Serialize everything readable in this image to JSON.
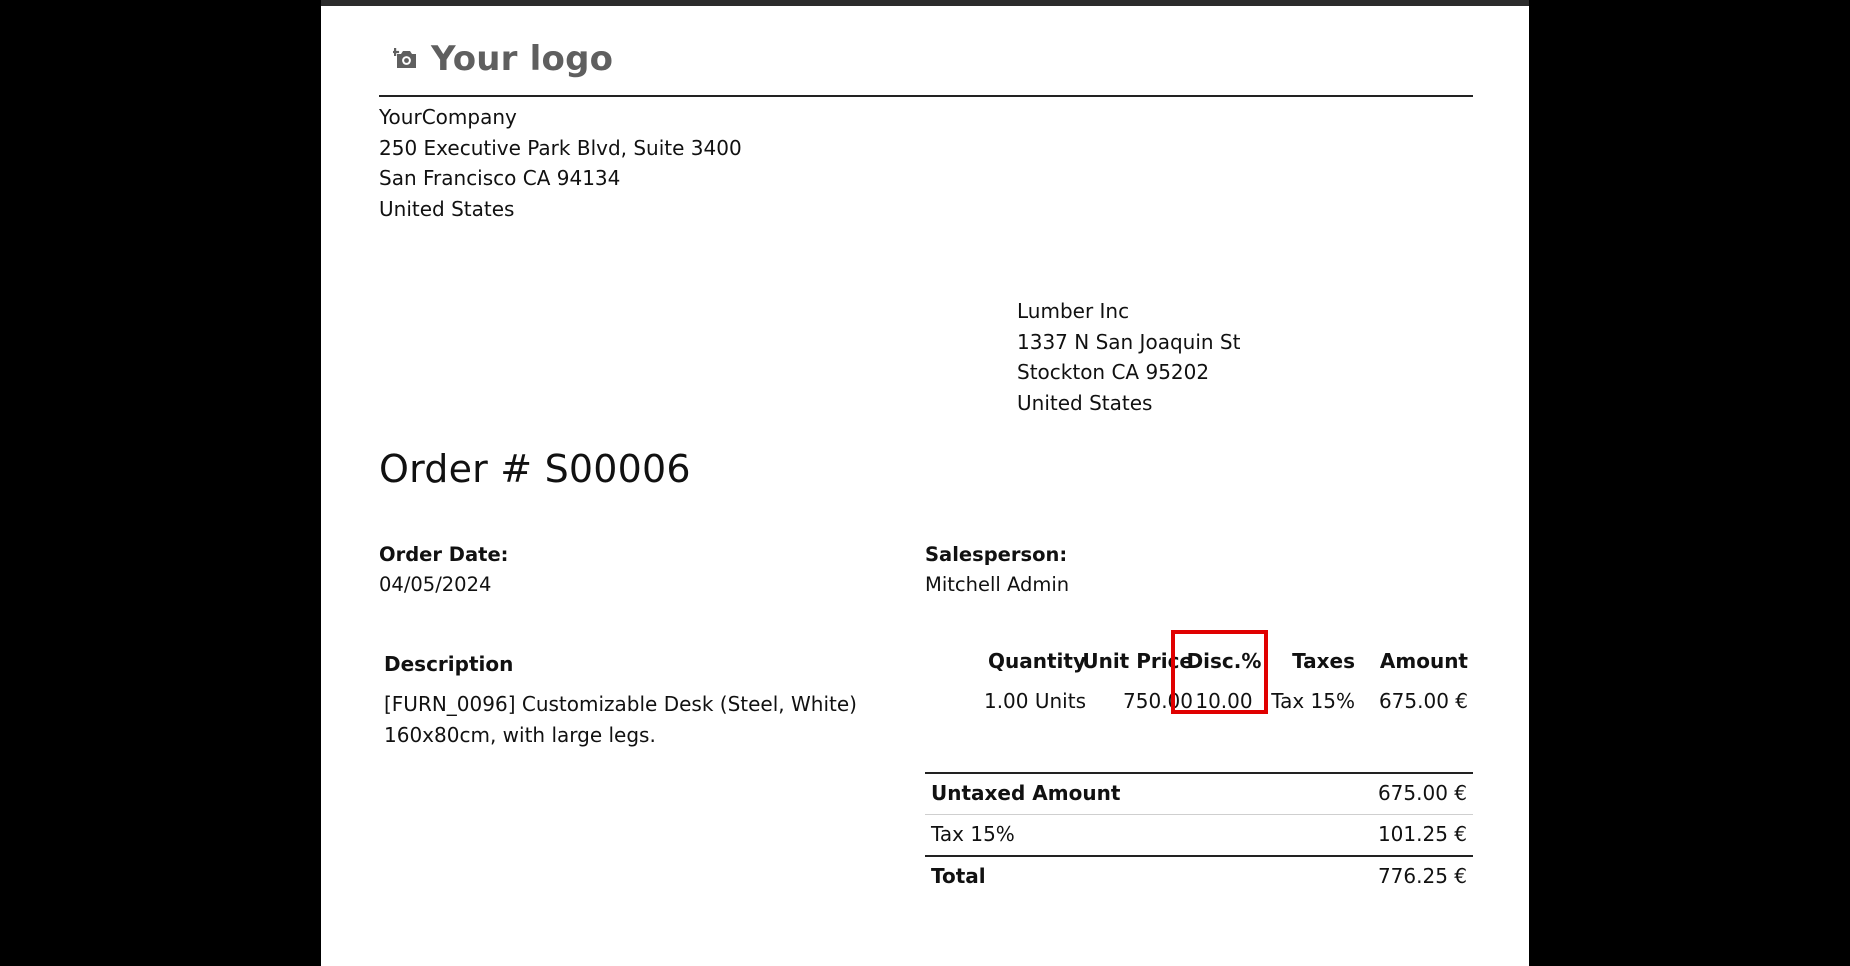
{
  "logo": {
    "text": "Your logo",
    "icon": "camera-plus-icon"
  },
  "company": {
    "name": "YourCompany",
    "address_line_1": "250 Executive Park Blvd, Suite 3400",
    "address_line_2": "San Francisco CA 94134",
    "country": "United States"
  },
  "customer": {
    "name": "Lumber Inc",
    "address_line_1": "1337 N San Joaquin St",
    "address_line_2": "Stockton CA 95202",
    "country": "United States"
  },
  "order": {
    "title": "Order # S00006",
    "date_label": "Order Date:",
    "date_value": "04/05/2024",
    "salesperson_label": "Salesperson:",
    "salesperson_value": "Mitchell Admin"
  },
  "line_items": {
    "headers": {
      "description": "Description",
      "quantity": "Quantity",
      "unit_price": "Unit Price",
      "discount": "Disc.%",
      "taxes": "Taxes",
      "amount": "Amount"
    },
    "rows": [
      {
        "description_line_1": "[FURN_0096] Customizable Desk (Steel, White)",
        "description_line_2": "160x80cm, with large legs.",
        "quantity": "1.00 Units",
        "unit_price": "750.00",
        "discount": "10.00",
        "taxes": "Tax 15%",
        "amount": "675.00 €"
      }
    ]
  },
  "totals": {
    "untaxed_label": "Untaxed Amount",
    "untaxed_value": "675.00 €",
    "tax_label": "Tax 15%",
    "tax_value": "101.25 €",
    "total_label": "Total",
    "total_value": "776.25 €"
  },
  "colors": {
    "background": "#000000",
    "page": "#ffffff",
    "text": "#111111",
    "logo_text": "#5f5f5f",
    "highlight": "#e00000"
  }
}
